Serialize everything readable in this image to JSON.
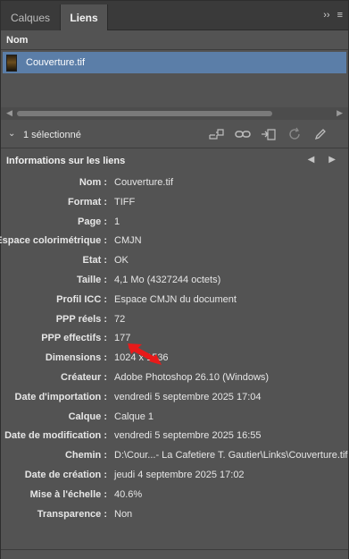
{
  "tabs": [
    {
      "label": "Calques",
      "active": false
    },
    {
      "label": "Liens",
      "active": true
    }
  ],
  "tab_icons": {
    "collapse": "››",
    "menu": "≡"
  },
  "column_header": "Nom",
  "links": [
    {
      "name": "Couverture.tif",
      "selected": true
    }
  ],
  "status": "1 sélectionné",
  "toolbar_icons": [
    "relink-cc-icon",
    "relink-icon",
    "goto-link-icon",
    "update-link-icon",
    "edit-original-icon"
  ],
  "info_title": "Informations sur les liens",
  "info": [
    {
      "label": "Nom :",
      "value": "Couverture.tif"
    },
    {
      "label": "Format :",
      "value": "TIFF"
    },
    {
      "label": "Page :",
      "value": "1"
    },
    {
      "label": "Espace colorimétrique :",
      "value": "CMJN"
    },
    {
      "label": "Etat :",
      "value": "OK"
    },
    {
      "label": "Taille :",
      "value": "4,1 Mo (4327244 octets)"
    },
    {
      "label": "Profil ICC :",
      "value": "Espace CMJN du document"
    },
    {
      "label": "PPP réels :",
      "value": "72"
    },
    {
      "label": "PPP effectifs :",
      "value": "177"
    },
    {
      "label": "Dimensions :",
      "value": "1024 x 1536"
    },
    {
      "label": "Créateur :",
      "value": "Adobe Photoshop 26.10 (Windows)"
    },
    {
      "label": "Date d'importation :",
      "value": "vendredi 5 septembre 2025 17:04"
    },
    {
      "label": "Calque :",
      "value": "Calque 1"
    },
    {
      "label": "Date de modification :",
      "value": "vendredi 5 septembre 2025 16:55"
    },
    {
      "label": "Chemin :",
      "value": "D:\\Cour...- La Cafetiere T. Gautier\\Links\\Couverture.tif"
    },
    {
      "label": "Date de création :",
      "value": "jeudi 4 septembre 2025 17:02"
    },
    {
      "label": "Mise à l'échelle :",
      "value": "40.6%"
    },
    {
      "label": "Transparence :",
      "value": "Non"
    }
  ],
  "colors": {
    "panel": "#535353",
    "selection": "#5b7ea8",
    "annotation": "#e81a1a"
  }
}
